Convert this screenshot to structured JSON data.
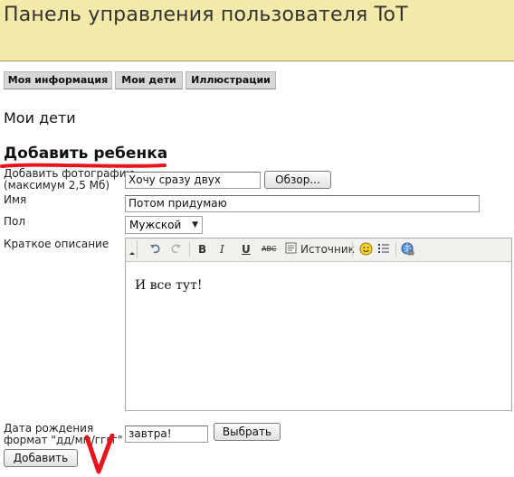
{
  "header": {
    "title": "Панель управления пользователя ToT"
  },
  "tabs": [
    {
      "label": "Моя информация"
    },
    {
      "label": "Мои дети"
    },
    {
      "label": "Иллюстрации"
    }
  ],
  "page": {
    "section_title": "Мои дети",
    "subsection_title": "Добавить ребенка"
  },
  "form": {
    "photo": {
      "label_line1": "Добавить фотографию",
      "label_line2": "(максимум 2,5 Мб)",
      "value": "Хочу сразу двух",
      "browse_label": "Обзор..."
    },
    "name": {
      "label": "Имя",
      "value": "Потом придумаю"
    },
    "gender": {
      "label": "Пол",
      "value": "Мужской"
    },
    "description": {
      "label": "Краткое описание",
      "content": "И все тут!"
    },
    "birthdate": {
      "label_line1": "Дата рождения",
      "label_line2": "формат \"дд/мм/гггг\"",
      "value": "завтра!",
      "choose_label": "Выбрать"
    },
    "submit_label": "Добавить"
  },
  "editor_toolbar": {
    "bold": "B",
    "italic": "I",
    "underline": "U",
    "strike": "ABC",
    "source_label": "Источник",
    "icons": [
      "undo-icon",
      "redo-icon",
      "source-icon",
      "smiley-icon",
      "list-icon",
      "link-icon"
    ]
  },
  "colors": {
    "header_bg": "#f3e9a9",
    "annotation_red": "#e8141c"
  }
}
